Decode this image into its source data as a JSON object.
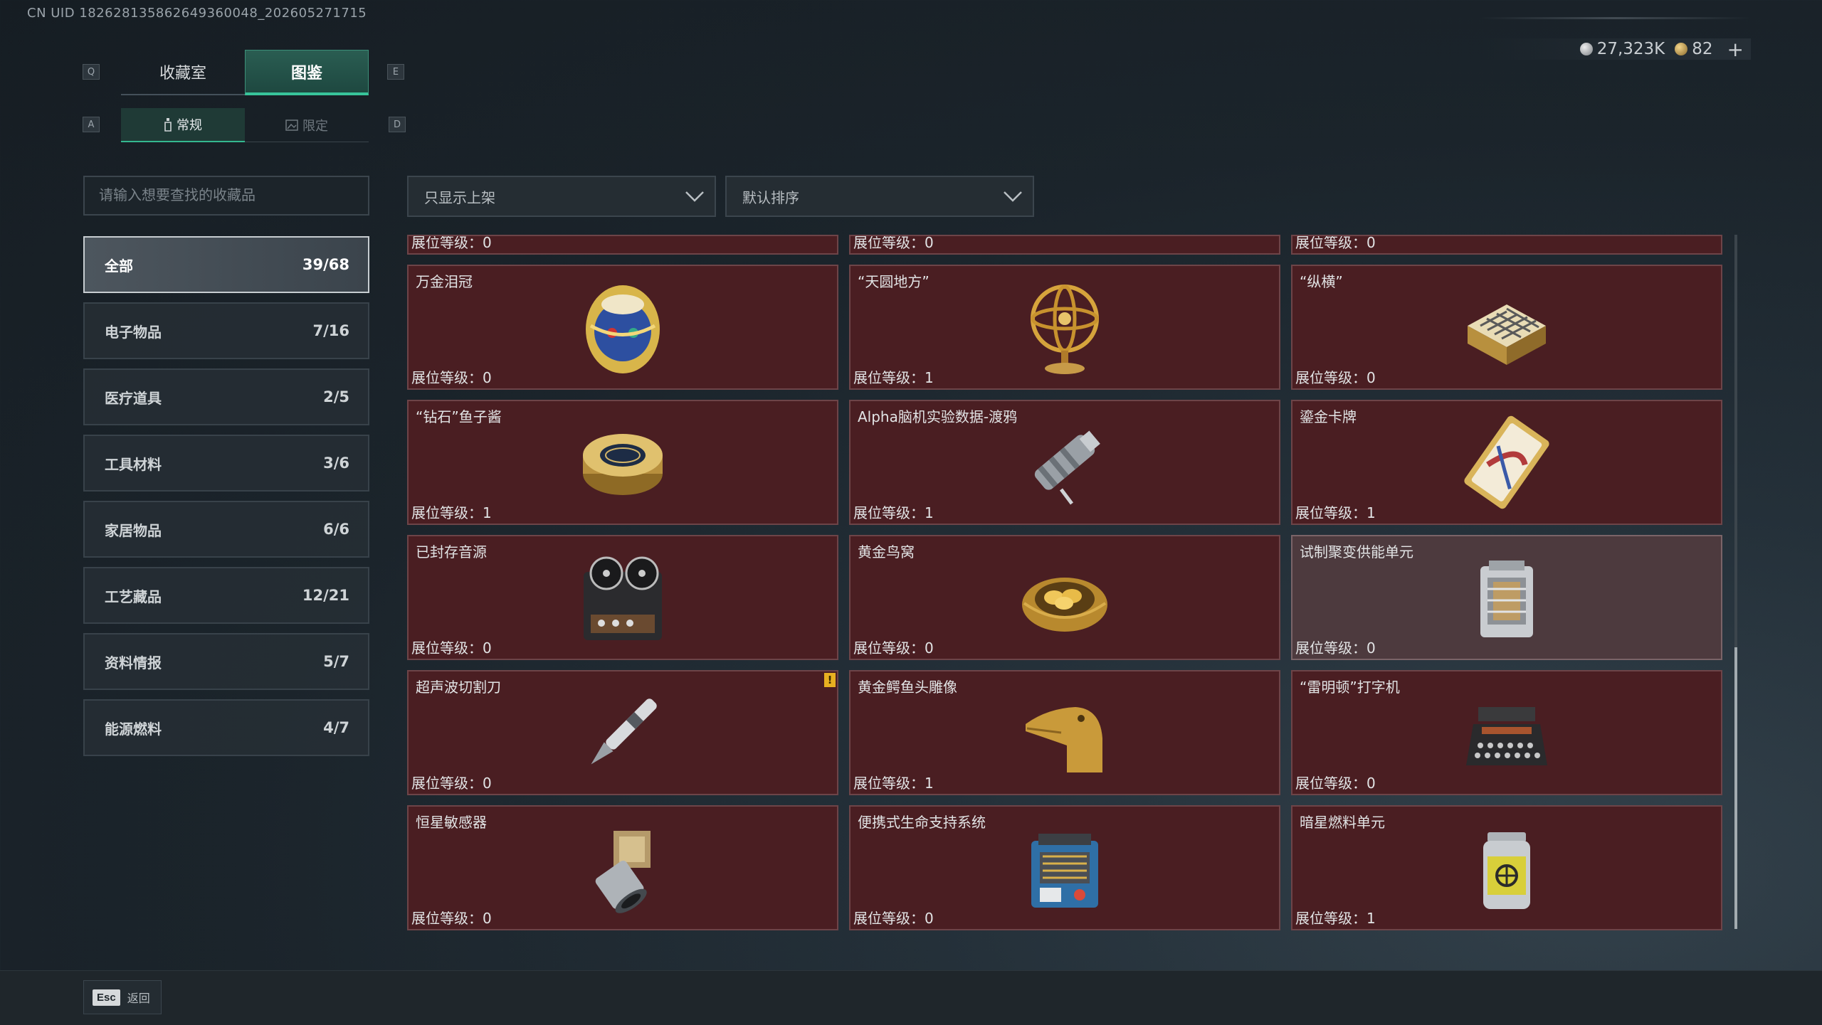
{
  "uid_text": "CN UID 182628135862649360048_202605271715",
  "currency": {
    "silver": "27,323K",
    "gold": "82",
    "plus": "+"
  },
  "keys": {
    "q": "Q",
    "e": "E",
    "a": "A",
    "d": "D"
  },
  "tabs": [
    {
      "label": "收藏室"
    },
    {
      "label": "图鉴"
    }
  ],
  "subtabs": [
    {
      "label": "常规",
      "icon": "bottle-icon"
    },
    {
      "label": "限定",
      "icon": "image-icon"
    }
  ],
  "search": {
    "placeholder": "请输入想要查找的收藏品"
  },
  "filter_dropdown": {
    "value": "只显示上架"
  },
  "sort_dropdown": {
    "value": "默认排序"
  },
  "categories": [
    {
      "label": "全部",
      "count": "39/68"
    },
    {
      "label": "电子物品",
      "count": "7/16"
    },
    {
      "label": "医疗道具",
      "count": "2/5"
    },
    {
      "label": "工具材料",
      "count": "3/6"
    },
    {
      "label": "家居物品",
      "count": "6/6"
    },
    {
      "label": "工艺藏品",
      "count": "12/21"
    },
    {
      "label": "资料情报",
      "count": "5/7"
    },
    {
      "label": "能源燃料",
      "count": "4/7"
    }
  ],
  "partial_row": [
    "展位等级：0",
    "展位等级：0",
    "展位等级：0"
  ],
  "items": [
    {
      "name": "万金泪冠",
      "level": "展位等级：0",
      "icon": "jeweled-egg-icon"
    },
    {
      "name": "“天圆地方”",
      "level": "展位等级：1",
      "icon": "armillary-sphere-icon"
    },
    {
      "name": "“纵横”",
      "level": "展位等级：0",
      "icon": "chess-box-icon"
    },
    {
      "name": "“钻石”鱼子酱",
      "level": "展位等级：1",
      "icon": "caviar-tin-icon"
    },
    {
      "name": "Alpha脑机实验数据-渡鸦",
      "level": "展位等级：1",
      "icon": "data-cylinder-icon"
    },
    {
      "name": "鎏金卡牌",
      "level": "展位等级：1",
      "icon": "gilded-card-icon"
    },
    {
      "name": "已封存音源",
      "level": "展位等级：0",
      "icon": "tape-recorder-icon"
    },
    {
      "name": "黄金鸟窝",
      "level": "展位等级：0",
      "icon": "golden-nest-icon"
    },
    {
      "name": "试制聚变供能单元",
      "level": "展位等级：0",
      "icon": "fusion-cell-icon"
    },
    {
      "name": "超声波切割刀",
      "level": "展位等级：0",
      "icon": "ultrasonic-knife-icon",
      "warning": "!"
    },
    {
      "name": "黄金鳄鱼头雕像",
      "level": "展位等级：1",
      "icon": "crocodile-statue-icon"
    },
    {
      "name": "“雷明顿”打字机",
      "level": "展位等级：0",
      "icon": "typewriter-icon"
    },
    {
      "name": "恒星敏感器",
      "level": "展位等级：0",
      "icon": "star-sensor-icon"
    },
    {
      "name": "便携式生命支持系统",
      "level": "展位等级：0",
      "icon": "life-support-icon"
    },
    {
      "name": "暗星燃料单元",
      "level": "展位等级：1",
      "icon": "fuel-canister-icon"
    }
  ],
  "esc": {
    "key": "Esc",
    "label": "返回"
  },
  "colors": {
    "accent": "#38c49a",
    "card_bg": "#4a1e22",
    "card_border": "#6d4448",
    "warning": "#e8b021"
  }
}
